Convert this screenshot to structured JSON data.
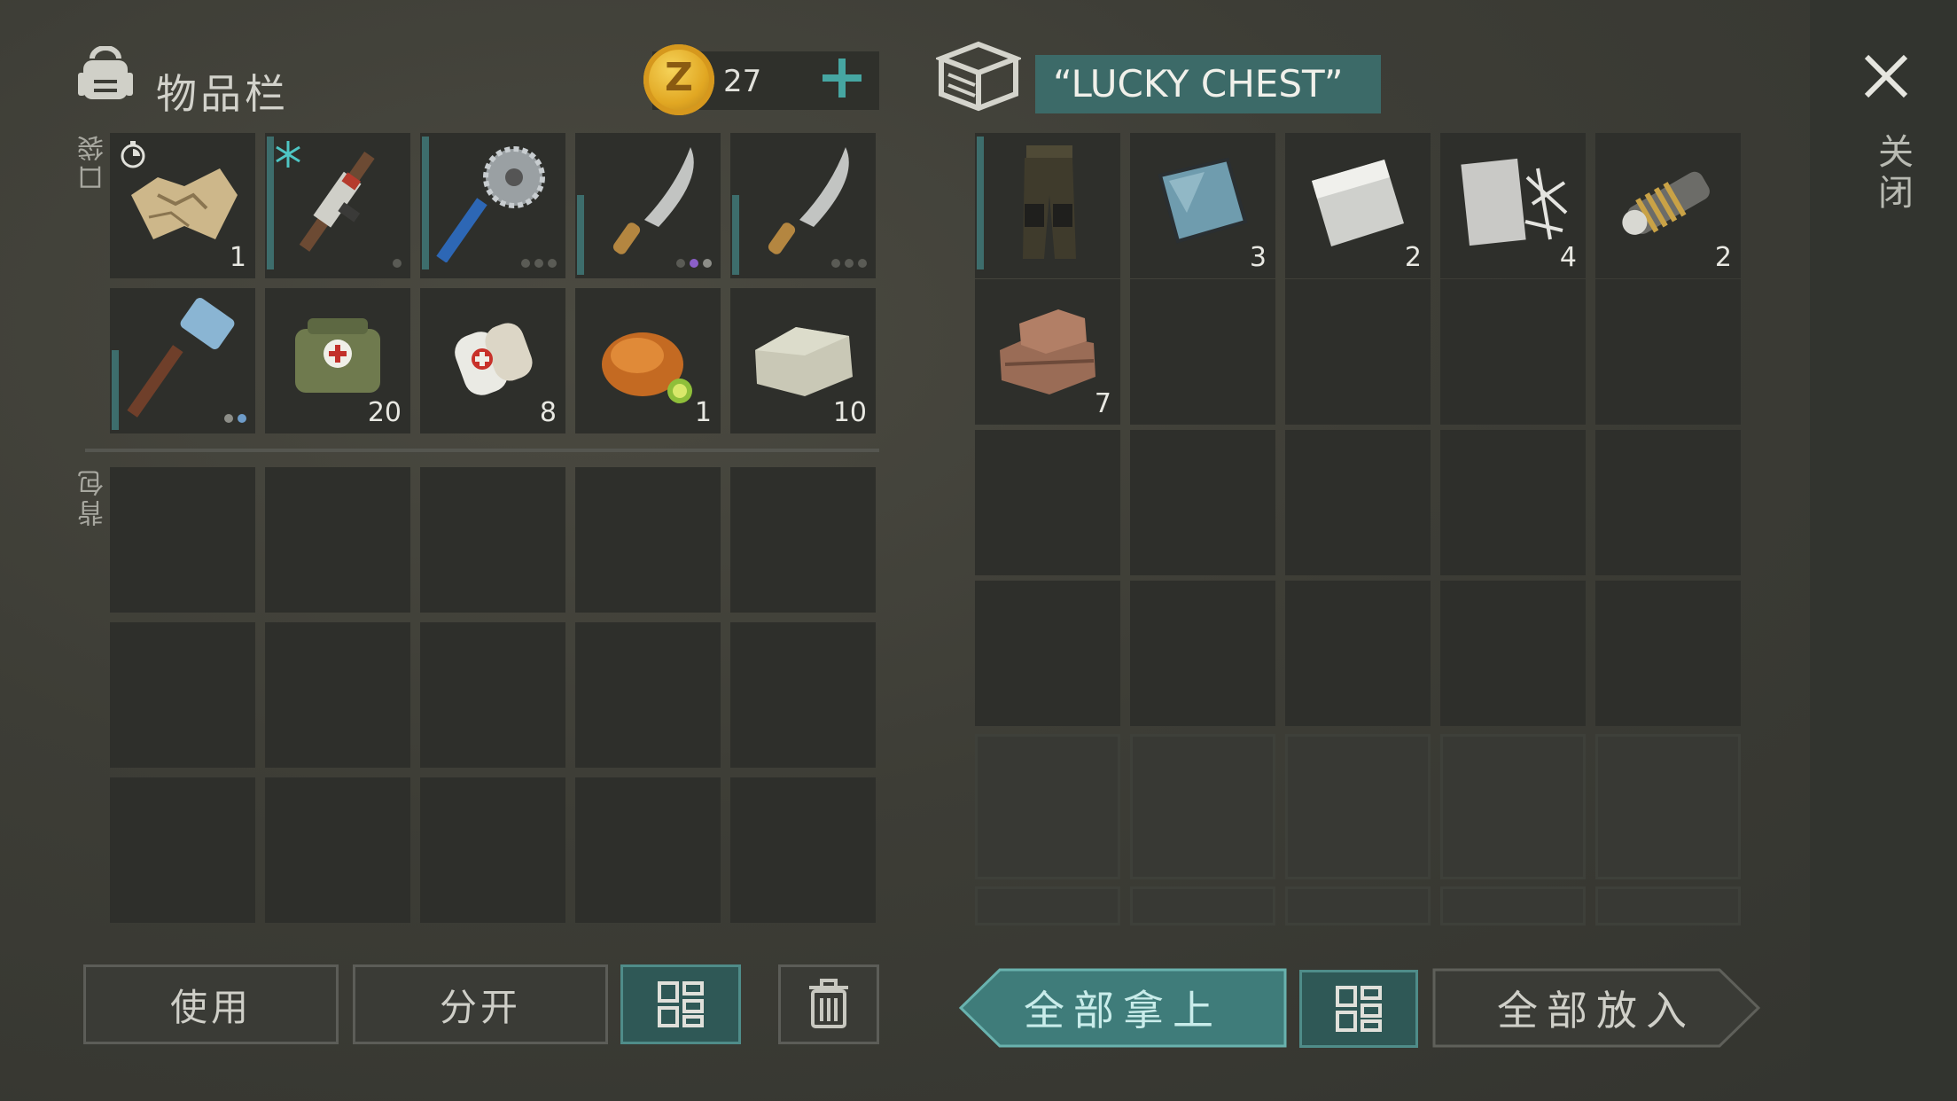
{
  "header": {
    "title": "物品栏",
    "coin_count": "27",
    "icons": [
      "backpack-icon",
      "gold-coin-icon",
      "plus-icon"
    ],
    "coin_letter": "Z"
  },
  "side_labels": {
    "pockets": "口袋",
    "backpack": "背包"
  },
  "pockets": [
    {
      "name": "map-item",
      "qty": "1",
      "icon": "map-icon"
    },
    {
      "name": "rifle-item",
      "qty": "",
      "icon": "rifle-icon"
    },
    {
      "name": "saw-axe-item",
      "qty": "",
      "icon": "saw-axe-icon"
    },
    {
      "name": "machete-item-1",
      "qty": "",
      "icon": "machete-icon"
    },
    {
      "name": "machete-item-2",
      "qty": "",
      "icon": "machete-icon"
    },
    {
      "name": "hammer-item",
      "qty": "",
      "icon": "hammer-icon"
    },
    {
      "name": "medkit-item",
      "qty": "20",
      "icon": "medkit-icon"
    },
    {
      "name": "bandage-item",
      "qty": "8",
      "icon": "bandage-icon"
    },
    {
      "name": "roast-chicken-item",
      "qty": "1",
      "icon": "roast-chicken-icon"
    },
    {
      "name": "stone-item",
      "qty": "10",
      "icon": "stone-icon"
    }
  ],
  "chest": {
    "title": "“LUCKY CHEST”",
    "items": [
      {
        "name": "pants-item",
        "qty": "",
        "icon": "pants-icon"
      },
      {
        "name": "glass-item",
        "qty": "3",
        "icon": "glass-sheet-icon"
      },
      {
        "name": "metal-plate-item",
        "qty": "2",
        "icon": "metal-plate-icon"
      },
      {
        "name": "fabric-item",
        "qty": "4",
        "icon": "fabric-icon"
      },
      {
        "name": "spring-item",
        "qty": "2",
        "icon": "spring-icon"
      },
      {
        "name": "bricks-item",
        "qty": "7",
        "icon": "bricks-icon"
      }
    ]
  },
  "close_label": "关闭",
  "buttons": {
    "use": "使用",
    "split": "分开",
    "take_all": "全部拿上",
    "put_all": "全部放入"
  },
  "colors": {
    "accent": "#3c6a68",
    "teal_border": "#4f8c89"
  }
}
